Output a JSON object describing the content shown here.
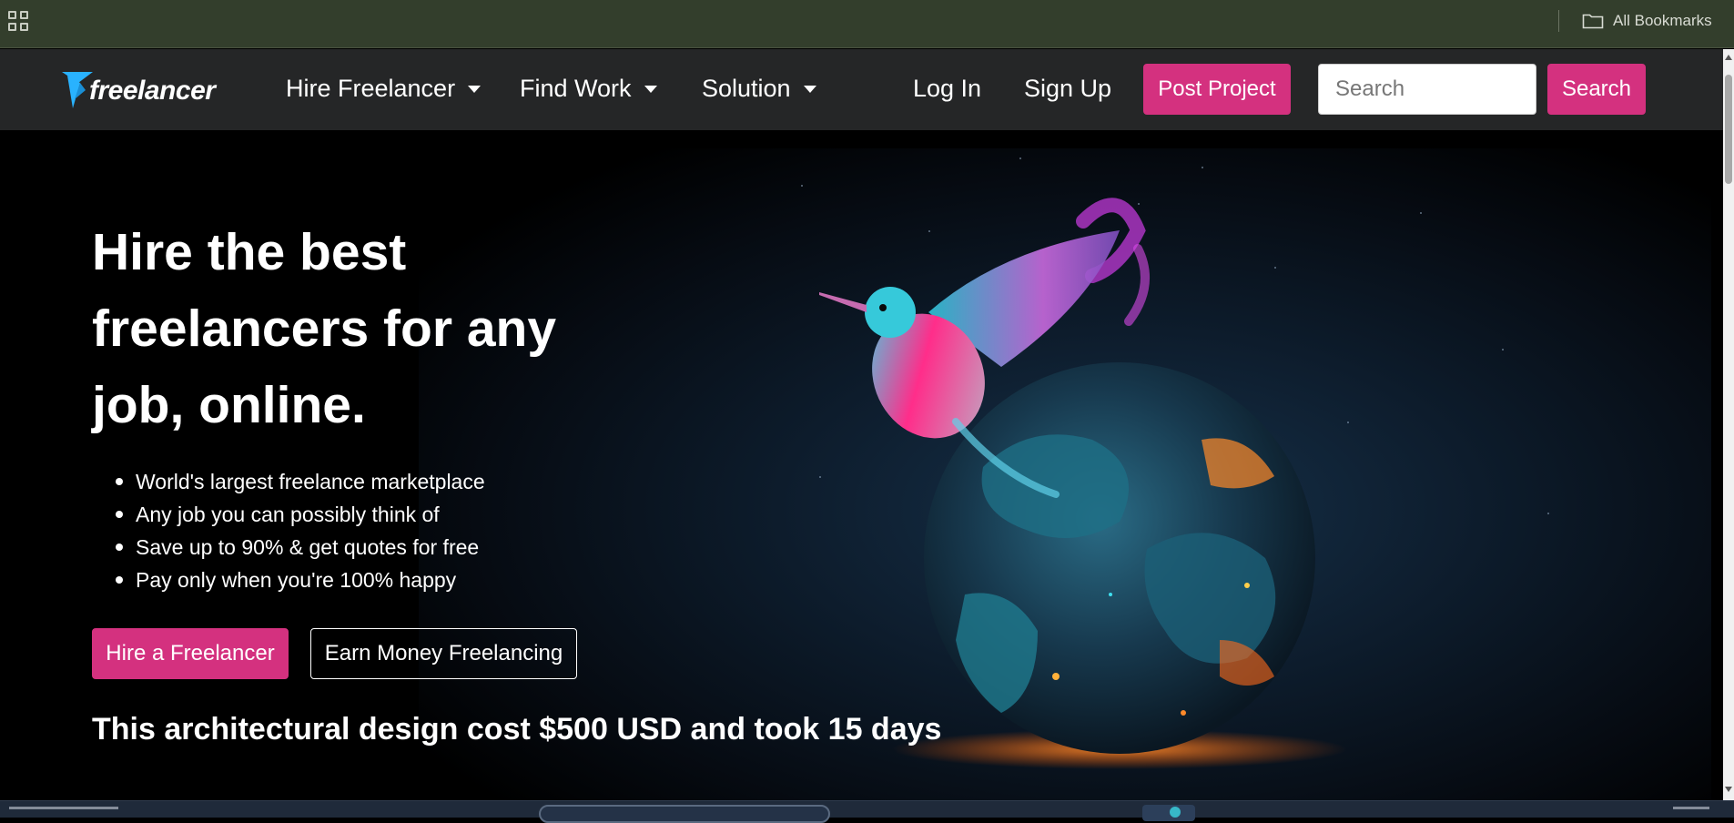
{
  "browser": {
    "bookmarks_label": "All Bookmarks"
  },
  "navbar": {
    "logo_text": "freelancer",
    "menus": [
      {
        "label": "Hire Freelancer"
      },
      {
        "label": "Find Work"
      },
      {
        "label": "Solution"
      }
    ],
    "login_label": "Log In",
    "signup_label": "Sign Up",
    "post_project_label": "Post Project",
    "search_placeholder": "Search",
    "search_button_label": "Search"
  },
  "hero": {
    "title": "Hire the best freelancers for any job, online.",
    "bullets": [
      "World's largest freelance marketplace",
      "Any job you can possibly think of",
      "Save up to 90% & get quotes for free",
      "Pay only when you're 100% happy"
    ],
    "hire_button_label": "Hire a Freelancer",
    "earn_button_label": "Earn Money Freelancing",
    "caption": "This architectural design cost $500 USD and took 15 days"
  },
  "colors": {
    "brand_pink": "#d4317f",
    "navbar_bg": "#252627",
    "bookmarks_bg": "#333e2c",
    "logo_blue": "#29b2fe"
  },
  "icons": {
    "apps": "apps-grid-icon",
    "folder": "folder-icon",
    "logo_mark": "freelancer-bird-logo-icon",
    "caret": "caret-down-icon"
  }
}
